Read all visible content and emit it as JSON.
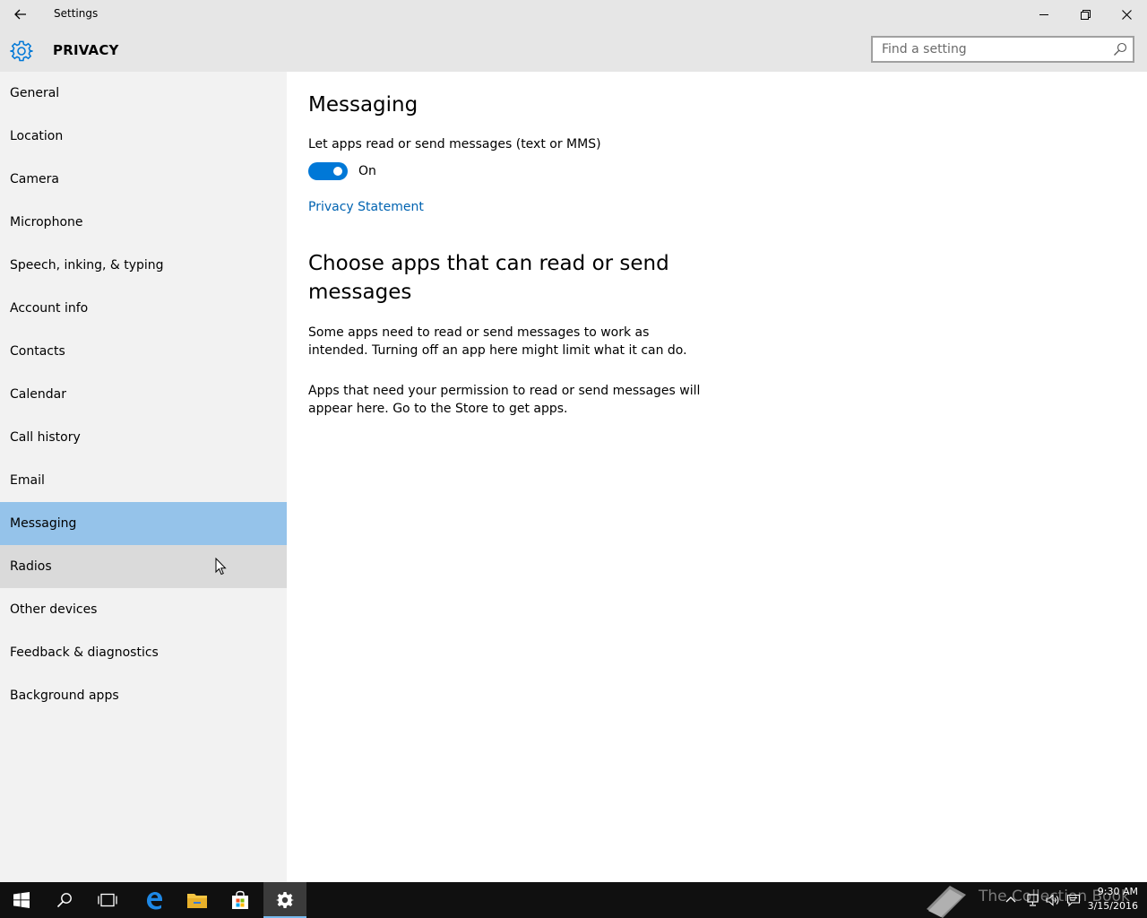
{
  "window": {
    "title": "Settings"
  },
  "header": {
    "section": "PRIVACY",
    "search_placeholder": "Find a setting"
  },
  "sidebar": {
    "items": [
      {
        "label": "General"
      },
      {
        "label": "Location"
      },
      {
        "label": "Camera"
      },
      {
        "label": "Microphone"
      },
      {
        "label": "Speech, inking, & typing"
      },
      {
        "label": "Account info"
      },
      {
        "label": "Contacts"
      },
      {
        "label": "Calendar"
      },
      {
        "label": "Call history"
      },
      {
        "label": "Email"
      },
      {
        "label": "Messaging"
      },
      {
        "label": "Radios"
      },
      {
        "label": "Other devices"
      },
      {
        "label": "Feedback & diagnostics"
      },
      {
        "label": "Background apps"
      }
    ],
    "selected": "Messaging",
    "hovered": "Radios"
  },
  "main": {
    "title": "Messaging",
    "toggle_label": "Let apps read or send messages (text or MMS)",
    "toggle_state": "On",
    "toggle_on": true,
    "privacy_link": "Privacy Statement",
    "choose_heading": "Choose apps that can read or send messages",
    "desc1": "Some apps need to read or send messages to work as intended. Turning off an app here might limit what it can do.",
    "desc2": "Apps that need your permission to read or send messages will appear here. Go to the Store to get apps."
  },
  "taskbar": {
    "apps": [
      "start-icon",
      "search-icon",
      "task-view-icon",
      "edge-icon",
      "file-explorer-icon",
      "store-icon",
      "settings-icon"
    ],
    "active_app": "settings-icon",
    "watermark": "The Collection Book",
    "time": "9:30 AM",
    "date": "3/15/2016"
  },
  "colors": {
    "accent": "#0078d7",
    "selected_nav": "#95c3ea",
    "hover_nav": "#dadada",
    "sidebar_bg": "#f2f2f2",
    "titlebar_bg": "#e6e6e6",
    "link": "#0063b1",
    "taskbar_bg": "#101010"
  }
}
